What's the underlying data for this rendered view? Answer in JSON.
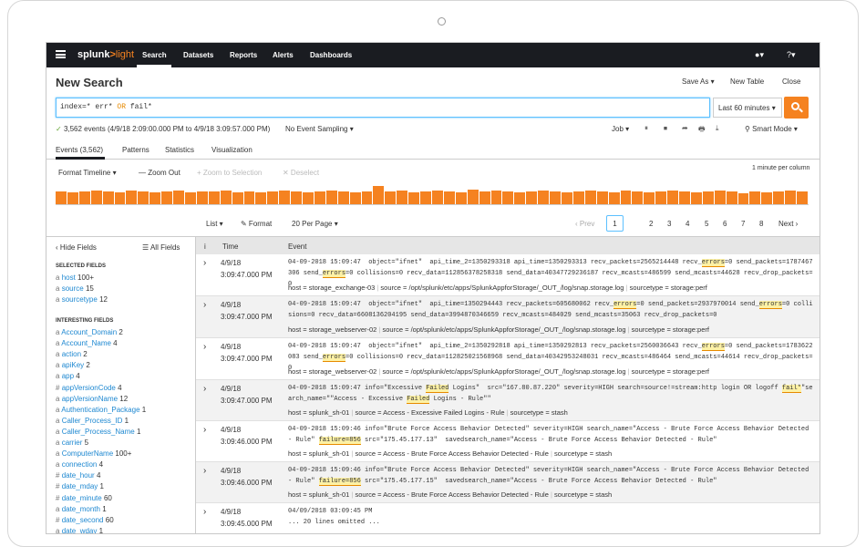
{
  "nav": {
    "logo_main": "splunk",
    "logo_gt": ">",
    "logo_light": "light",
    "items": [
      "Search",
      "Datasets",
      "Reports",
      "Alerts",
      "Dashboards"
    ],
    "user_menu": "▾",
    "help_menu": "?▾"
  },
  "header": {
    "title": "New Search",
    "save_as": "Save As ▾",
    "new_table": "New Table",
    "close": "Close"
  },
  "search": {
    "query_prefix": "index=* err* ",
    "query_or": "OR",
    "query_suffix": " fail*",
    "time_range": "Last 60 minutes ▾"
  },
  "status": {
    "check": "✓",
    "text": "3,562 events (4/9/18 2:09:00.000 PM to 4/9/18 3:09:57.000 PM)",
    "sampling": "No Event Sampling ▾",
    "job": "Job ▾",
    "smart_mode": "⚲ Smart Mode ▾",
    "icons": [
      "⏸",
      "⏹",
      "➦",
      "🖶",
      "⤓"
    ]
  },
  "tabs": [
    "Events (3,562)",
    "Patterns",
    "Statistics",
    "Visualization"
  ],
  "timeline": {
    "format": "Format Timeline ▾",
    "zoom_out": "— Zoom Out",
    "zoom_sel": "+ Zoom to Selection",
    "deselect": "✕ Deselect",
    "scale": "1 minute per column",
    "bars": [
      14,
      13,
      14,
      15,
      14,
      13,
      15,
      14,
      13,
      14,
      15,
      13,
      14,
      14,
      15,
      13,
      14,
      13,
      14,
      15,
      14,
      13,
      14,
      15,
      14,
      13,
      14,
      20,
      14,
      15,
      13,
      14,
      15,
      14,
      13,
      16,
      14,
      15,
      14,
      13,
      14,
      15,
      14,
      13,
      14,
      15,
      14,
      13,
      15,
      14,
      13,
      14,
      15,
      14,
      13,
      14,
      15,
      14,
      12,
      14,
      13,
      14,
      15,
      14
    ],
    "color": "#f58220"
  },
  "pager": {
    "list": "List ▾",
    "format": "✎ Format",
    "per_page": "20 Per Page ▾",
    "prev": "‹ Prev",
    "pages": [
      "1",
      "2",
      "3",
      "4",
      "5",
      "6",
      "7",
      "8"
    ],
    "ellipsis": "...",
    "next": "Next ›"
  },
  "sidebar": {
    "hide_fields": "‹ Hide Fields",
    "all_fields": "☰ All Fields",
    "selected_head": "SELECTED FIELDS",
    "selected": [
      {
        "t": "a",
        "name": "host",
        "count": "100+"
      },
      {
        "t": "a",
        "name": "source",
        "count": "15"
      },
      {
        "t": "a",
        "name": "sourcetype",
        "count": "12"
      }
    ],
    "interesting_head": "INTERESTING FIELDS",
    "interesting": [
      {
        "t": "a",
        "name": "Account_Domain",
        "count": "2"
      },
      {
        "t": "a",
        "name": "Account_Name",
        "count": "4"
      },
      {
        "t": "a",
        "name": "action",
        "count": "2"
      },
      {
        "t": "a",
        "name": "apiKey",
        "count": "2"
      },
      {
        "t": "a",
        "name": "app",
        "count": "4"
      },
      {
        "t": "#",
        "name": "appVersionCode",
        "count": "4"
      },
      {
        "t": "a",
        "name": "appVersionName",
        "count": "12"
      },
      {
        "t": "a",
        "name": "Authentication_Package",
        "count": "1"
      },
      {
        "t": "a",
        "name": "Caller_Process_ID",
        "count": "1"
      },
      {
        "t": "a",
        "name": "Caller_Process_Name",
        "count": "1"
      },
      {
        "t": "a",
        "name": "carrier",
        "count": "5"
      },
      {
        "t": "a",
        "name": "ComputerName",
        "count": "100+"
      },
      {
        "t": "a",
        "name": "connection",
        "count": "4"
      },
      {
        "t": "#",
        "name": "date_hour",
        "count": "4"
      },
      {
        "t": "#",
        "name": "date_mday",
        "count": "1"
      },
      {
        "t": "#",
        "name": "date_minute",
        "count": "60"
      },
      {
        "t": "a",
        "name": "date_month",
        "count": "1"
      },
      {
        "t": "#",
        "name": "date_second",
        "count": "60"
      },
      {
        "t": "a",
        "name": "date_wday",
        "count": "1"
      }
    ]
  },
  "events": {
    "col_info": "i",
    "col_time": "Time",
    "col_event": "Event",
    "rows": [
      {
        "date": "4/9/18",
        "time": "3:09:47.000 PM",
        "raw": "04-09-2018 15:09:47  object=\"ifnet\"  api_time_2=1350293318 api_time=1350293313 recv_packets=2565214448 recv_errors=0 send_packets=1787467306 send_errors=0 collisions=0 recv_data=112856378258318 send_data=40347729236187 recv_mcasts=486599 send_mcasts=44628 recv_drop_packets=0",
        "host": "storage_exchange-03",
        "source": "/opt/splunk/etc/apps/SplunkAppforStorage/_OUT_/log/snap.storage.log",
        "sourcetype": "storage:perf"
      },
      {
        "date": "4/9/18",
        "time": "3:09:47.000 PM",
        "raw": "04-09-2018 15:09:47  object=\"ifnet\"  api_time=1350294443 recv_packets=605680062 recv_errors=0 send_packets=2937970014 send_errors=0 collisions=0 recv_data=6608136204195 send_data=3994870346659 recv_mcasts=484029 send_mcasts=35063 recv_drop_packets=0",
        "host": "storage_webserver-02",
        "source": "/opt/splunk/etc/apps/SplunkAppforStorage/_OUT_/log/snap.storage.log",
        "sourcetype": "storage:perf"
      },
      {
        "date": "4/9/18",
        "time": "3:09:47.000 PM",
        "raw": "04-09-2018 15:09:47  object=\"ifnet\"  api_time_2=1350292818 api_time=1350292813 recv_packets=2560036643 recv_errors=0 send_packets=1783622083 send_errors=0 collisions=0 recv_data=112825021568968 send_data=40342953248031 recv_mcasts=486464 send_mcasts=44614 recv_drop_packets=0",
        "host": "storage_webserver-02",
        "source": "/opt/splunk/etc/apps/SplunkAppforStorage/_OUT_/log/snap.storage.log",
        "sourcetype": "storage:perf"
      },
      {
        "date": "4/9/18",
        "time": "3:09:47.000 PM",
        "raw": "04-09-2018 15:09:47 info=\"Excessive Failed Logins\"  src=\"167.80.87.220\" severity=HIGH search=source!=stream:http login OR logoff fail*\"search_name=\"\"Access - Excessive Failed Logins - Rule\"\"",
        "host": "splunk_sh-01",
        "source": "Access - Excessive Failed Logins - Rule",
        "sourcetype": "stash"
      },
      {
        "date": "4/9/18",
        "time": "3:09:46.000 PM",
        "raw": "04-09-2018 15:09:46 info=\"Brute Force Access Behavior Detected\" severity=HIGH search_name=\"Access - Brute Force Access Behavior Detected - Rule\" failure=856 src=\"175.45.177.13\"  savedsearch_name=\"Access - Brute Force Access Behavior Detected - Rule\"",
        "host": "splunk_sh-01",
        "source": "Access - Brute Force Access Behavior Detected - Rule",
        "sourcetype": "stash"
      },
      {
        "date": "4/9/18",
        "time": "3:09:46.000 PM",
        "raw": "04-09-2018 15:09:46 info=\"Brute Force Access Behavior Detected\" severity=HIGH search_name=\"Access - Brute Force Access Behavior Detected - Rule\" failure=856 src=\"175.45.177.15\"  savedsearch_name=\"Access - Brute Force Access Behavior Detected - Rule\"",
        "host": "splunk_sh-01",
        "source": "Access - Brute Force Access Behavior Detected - Rule",
        "sourcetype": "stash"
      },
      {
        "date": "4/9/18",
        "time": "3:09:45.000 PM",
        "raw": "04/09/2018 03:09:45 PM\n... 20 lines omitted ...",
        "host": "",
        "source": "",
        "sourcetype": ""
      }
    ]
  }
}
